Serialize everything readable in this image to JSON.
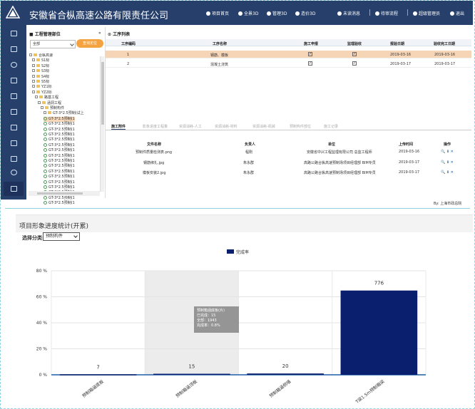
{
  "header": {
    "app_title": "安徽省合枞高速公路有限责任公司",
    "nav": [
      {
        "label": "项目首页",
        "icon": "home-icon"
      },
      {
        "label": "全景3D",
        "icon": "globe-icon"
      },
      {
        "label": "管理3D",
        "icon": "cube-icon"
      },
      {
        "label": "造价3D",
        "icon": "money-icon"
      },
      {
        "label": "未读消息",
        "icon": "message-icon"
      },
      {
        "label": "待审流程",
        "icon": "flow-icon"
      },
      {
        "label": "超级管理员",
        "icon": "user-icon"
      },
      {
        "label": "退出",
        "icon": "power-icon"
      }
    ]
  },
  "sidebar": {
    "icons": [
      "dashboard-icon",
      "folder-icon",
      "target-icon",
      "document-icon",
      "file-icon",
      "book-icon",
      "chart-icon",
      "tools-icon",
      "link-icon",
      "settings-icon",
      "grid-icon"
    ]
  },
  "tree_panel": {
    "title": "工程管理部位",
    "collapse": "«",
    "select_value": "全部",
    "query_button": "查询定位",
    "nodes": [
      {
        "label": "合枞高速",
        "type": "folder",
        "depth": 0
      },
      {
        "label": "S1标",
        "type": "folder",
        "depth": 1
      },
      {
        "label": "S2标",
        "type": "folder",
        "depth": 1
      },
      {
        "label": "S3标",
        "type": "folder",
        "depth": 1
      },
      {
        "label": "S4标",
        "type": "folder",
        "depth": 1
      },
      {
        "label": "S5标",
        "type": "folder",
        "depth": 1
      },
      {
        "label": "YZ1标",
        "type": "folder",
        "depth": 1
      },
      {
        "label": "YZ2标",
        "type": "folder",
        "depth": 1
      },
      {
        "label": "路基工程",
        "type": "folder",
        "depth": 2
      },
      {
        "label": "涵洞工程",
        "type": "folder",
        "depth": 3
      },
      {
        "label": "预制构件",
        "type": "folder",
        "depth": 4
      },
      {
        "label": "GT-3*2.5预制(试上",
        "type": "folder",
        "depth": 5
      },
      {
        "label": "GT-3*2.5预制(1",
        "type": "leaf",
        "depth": 5,
        "selected": true
      },
      {
        "label": "GT-3*2.5预制(1",
        "type": "leaf",
        "depth": 5
      },
      {
        "label": "GT-3*2.5预制(1",
        "type": "leaf",
        "depth": 5
      },
      {
        "label": "GT-3*2.5预制(1",
        "type": "leaf",
        "depth": 5
      },
      {
        "label": "GT-3*2.5预制(1",
        "type": "leaf",
        "depth": 5
      },
      {
        "label": "GT-3*2.5预制(1",
        "type": "leaf",
        "depth": 5
      },
      {
        "label": "GT-3*2.5预制(1",
        "type": "leaf",
        "depth": 5
      },
      {
        "label": "GT-3*2.5预制(1",
        "type": "leaf",
        "depth": 5
      },
      {
        "label": "GT-3*2.5预制(1",
        "type": "leaf",
        "depth": 5
      },
      {
        "label": "GT-3*2.5预制(1",
        "type": "leaf",
        "depth": 5
      },
      {
        "label": "GT-3*2.5预制(1",
        "type": "leaf",
        "depth": 5
      },
      {
        "label": "GT-3*2.5预制(1",
        "type": "leaf",
        "depth": 5
      },
      {
        "label": "GT-3*2.5预制(1",
        "type": "leaf",
        "depth": 5
      },
      {
        "label": "GT-3*2.5预制(1",
        "type": "leaf",
        "depth": 5
      },
      {
        "label": "GT-3*2.5预制(1",
        "type": "leaf",
        "depth": 5
      },
      {
        "label": "GT-3*2.5预制(1",
        "type": "leaf",
        "depth": 5
      },
      {
        "label": "GT-3*2.5预制(1",
        "type": "leaf",
        "depth": 5
      }
    ]
  },
  "process_panel": {
    "title": "工序列表",
    "columns": [
      "工序编码",
      "工序名称",
      "施工申报",
      "监理验收",
      "报验日期",
      "验收完工日期"
    ],
    "rows": [
      {
        "code": "1",
        "name": "钢筋、模板",
        "apply": true,
        "verify": true,
        "report_date": "2019-03-16",
        "done_date": "2019-03-16",
        "selected": true
      },
      {
        "code": "2",
        "name": "混凝土浇筑",
        "apply": true,
        "verify": true,
        "report_date": "2019-03-17",
        "done_date": "2019-03-17",
        "selected": false
      }
    ],
    "tabs": [
      "施工附件",
      "影象进度工程量",
      "资源消耗-人工",
      "资源消耗-材料",
      "资源消耗-机械",
      "预制构件部位",
      "施工记录"
    ],
    "file_columns": [
      "文件名称",
      "负责人",
      "单位",
      "上传时间",
      "操作"
    ],
    "files": [
      {
        "name": "预制件质量检测表.png",
        "person": "程刚",
        "unit": "安徽省中兴工程监理有限公司 总监工程师",
        "time": "2019-03-16"
      },
      {
        "name": "钢筋绑扎.jpg",
        "person": "朱永群",
        "unit": "高路公路合枞高速预制场项目经理部 BIM专员",
        "time": "2019-03-17"
      },
      {
        "name": "模板安装2.jpg",
        "person": "朱永群",
        "unit": "高路公路合枞高速预制场项目经理部 BIM专员",
        "time": "2019-03-17"
      }
    ],
    "op_icons": "🔍 ⬇ ✕",
    "footer": "By: 上海市政总院"
  },
  "chart_section": {
    "title": "项目形象进度统计(开累)",
    "category_label": "选择分类:",
    "category_value": "预制构件",
    "tooltip": {
      "title": "预制箱涵底板(片)",
      "line1": "已完成：15",
      "line2": "全部：1943",
      "line3": "完成率：0.8%"
    }
  },
  "chart_data": {
    "type": "bar",
    "categories": [
      "预制箱涵底板",
      "预制箱涵顶板",
      "预制箱涵侧墙",
      "T梁1.5m预制箱梁"
    ],
    "values": [
      7,
      15,
      20,
      776
    ],
    "percent": [
      0.4,
      0.8,
      1.0,
      64.8
    ],
    "ylim": [
      0,
      80
    ],
    "yticks": [
      "0 %",
      "20 %",
      "40 %",
      "60 %",
      "80 %"
    ],
    "legend": "完成率",
    "bar_color": "#0a1f6e",
    "grid": true,
    "highlight_index": 1
  }
}
